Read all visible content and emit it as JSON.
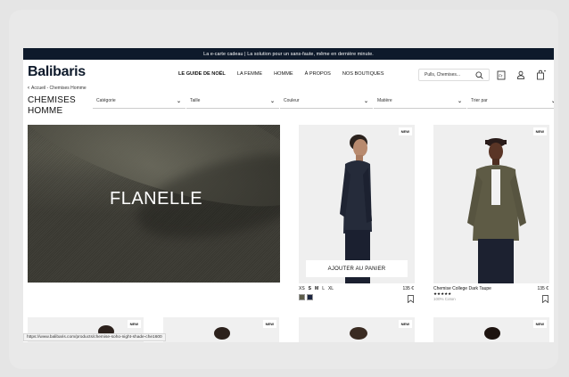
{
  "announcement": "La e-carte cadeau | La solution pour un sans-faute, même en dernière minute.",
  "brand": "Balibaris",
  "breadcrumb": "Accueil - Chemises Homme",
  "nav": [
    "LE GUIDE DE NOËL",
    "LA FEMME",
    "HOMME",
    "À PROPOS",
    "NOS BOUTIQUES"
  ],
  "search": {
    "placeholder": "Pulls, Chemises..."
  },
  "page_title_line1": "CHEMISES",
  "page_title_line2": "HOMME",
  "filters": [
    "Catégorie",
    "Taille",
    "Couleur",
    "Matière",
    "Trier par"
  ],
  "hero": {
    "text": "FLANELLE"
  },
  "products": [
    {
      "badge": "NEW",
      "hover_button": "AJOUTER AU PANIER",
      "sizes": [
        "XS",
        "S",
        "M",
        "L",
        "XL"
      ],
      "price": "135 €",
      "swatches": [
        "#5e5d4a",
        "#1c2540"
      ]
    },
    {
      "badge": "NEW",
      "name": "Chemise College Dark Taupe",
      "stars": "★★★★★",
      "material": "100% Coton",
      "price": "135 €"
    }
  ],
  "row2_badges": [
    "NEW",
    "NEW",
    "NEW",
    "NEW"
  ],
  "status_url": "https://www.balibaris.com/products/chemise-soho-night-shade-che1600",
  "colors": {
    "navy": "#0e1a2b",
    "page_bg": "#e9e9e9"
  }
}
